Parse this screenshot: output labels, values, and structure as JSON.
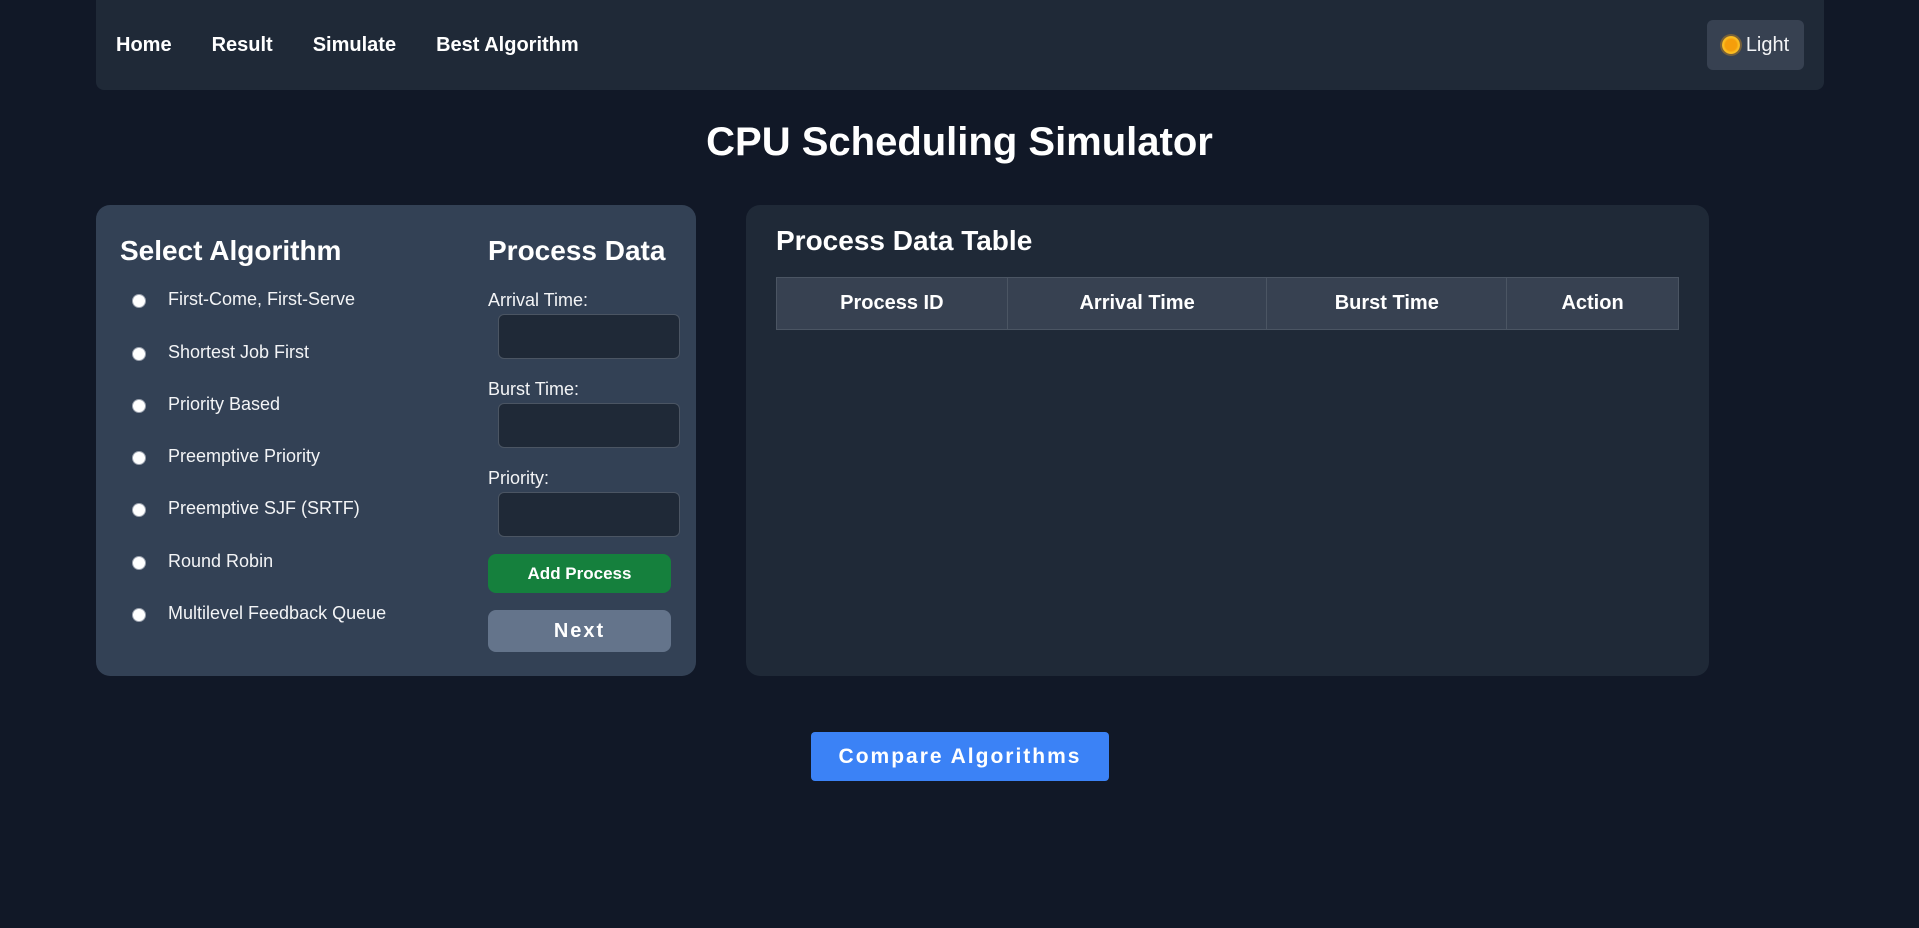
{
  "nav": {
    "links": [
      "Home",
      "Result",
      "Simulate",
      "Best Algorithm"
    ],
    "theme_toggle_label": "Light",
    "theme_icon": "sun-icon"
  },
  "page": {
    "title": "CPU Scheduling Simulator"
  },
  "algorithms": {
    "heading": "Select Algorithm",
    "options": [
      "First-Come, First-Serve",
      "Shortest Job First",
      "Priority Based",
      "Preemptive Priority",
      "Preemptive SJF (SRTF)",
      "Round Robin",
      "Multilevel Feedback Queue"
    ],
    "selected": null
  },
  "process_form": {
    "heading": "Process Data",
    "arrival_label": "Arrival Time:",
    "arrival_value": "",
    "burst_label": "Burst Time:",
    "burst_value": "",
    "priority_label": "Priority:",
    "priority_value": "",
    "add_button": "Add Process",
    "next_button": "Next"
  },
  "process_table": {
    "title": "Process Data Table",
    "columns": [
      "Process ID",
      "Arrival Time",
      "Burst Time",
      "Action"
    ],
    "rows": []
  },
  "compare_button": "Compare Algorithms",
  "colors": {
    "background": "#111827",
    "panel": "#1f2937",
    "left_panel": "#334155",
    "add_button": "#15803d",
    "next_button": "#64748b",
    "compare_button": "#3b82f6"
  }
}
